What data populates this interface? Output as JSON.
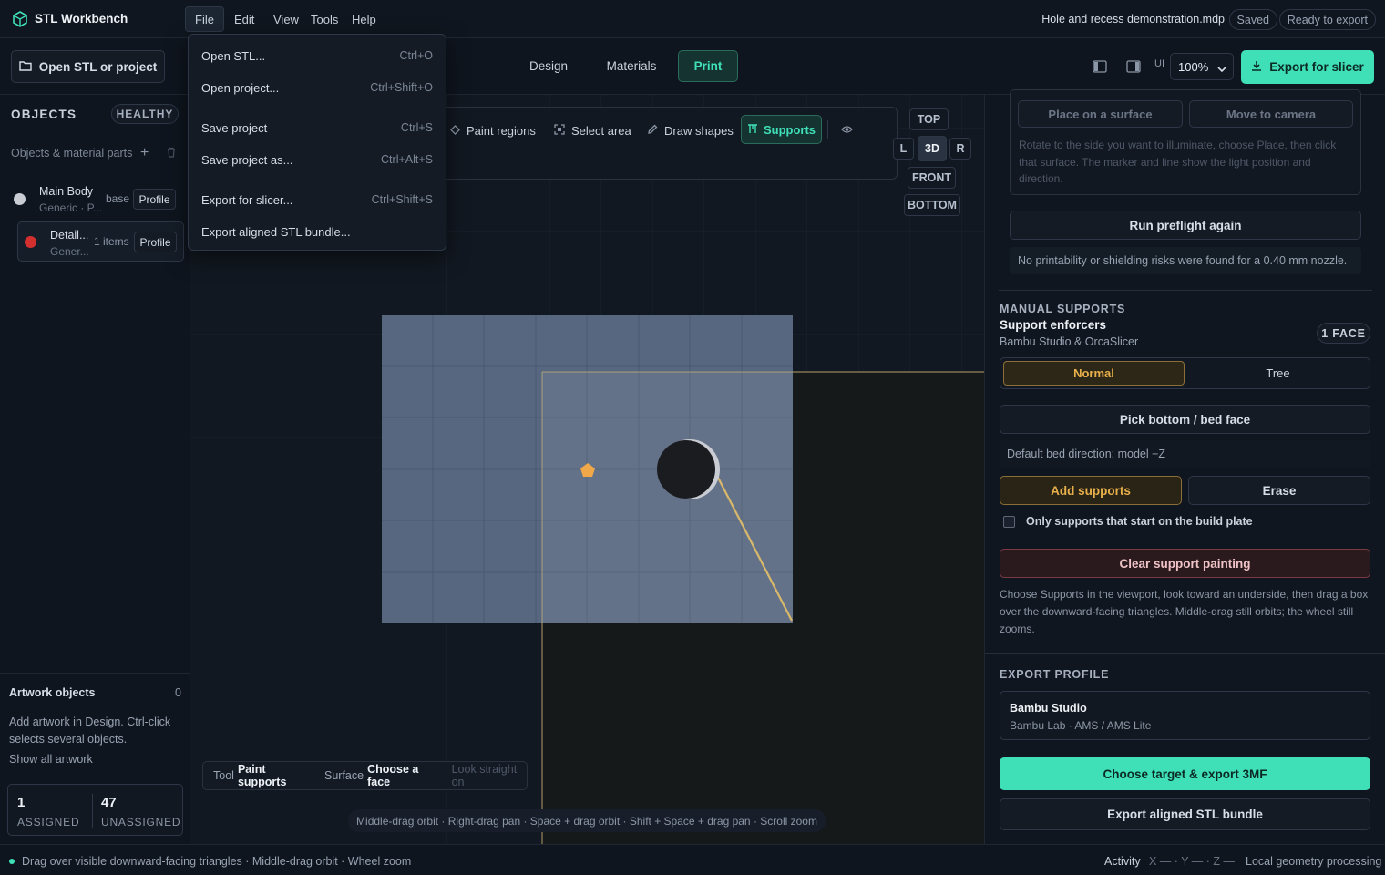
{
  "app": {
    "name": "STL Workbench",
    "file_name": "Hole and recess demonstration.mdp",
    "saved": "Saved",
    "status": "Ready to export"
  },
  "menubar": {
    "file": "File",
    "edit": "Edit",
    "view": "View",
    "tools": "Tools",
    "help": "Help"
  },
  "file_menu": [
    {
      "label": "Open STL...",
      "shortcut": "Ctrl+O"
    },
    {
      "label": "Open project...",
      "shortcut": "Ctrl+Shift+O"
    },
    {
      "label": "Save project",
      "shortcut": "Ctrl+S"
    },
    {
      "label": "Save project as...",
      "shortcut": "Ctrl+Alt+S"
    },
    {
      "label": "Export for slicer...",
      "shortcut": "Ctrl+Shift+S"
    },
    {
      "label": "Export aligned STL bundle...",
      "shortcut": ""
    }
  ],
  "toolbar": {
    "open_label": "Open STL or project",
    "tabs": [
      "Design",
      "Materials",
      "Print"
    ],
    "ui_label": "UI",
    "zoom": "100%",
    "export_label": "Export for slicer"
  },
  "sidebar": {
    "title": "OBJECTS",
    "health": "HEALTHY",
    "subtitle": "Objects & material parts",
    "objects": [
      {
        "name": "Main Body",
        "material": "Generic · P...",
        "tag": "base",
        "profile": "Profile",
        "color": "#c9ccd2"
      },
      {
        "name": "Detail...",
        "material": "Gener...",
        "tag": "1 items",
        "profile": "Profile",
        "color": "#d32f2f"
      }
    ],
    "artwork_title": "Artwork objects",
    "artwork_count": "0",
    "artwork_help": "Add artwork in Design. Ctrl-click selects several objects.",
    "show_all": "Show all artwork",
    "assigned_count": "1",
    "assigned_label": "ASSIGNED",
    "unassigned_count": "47",
    "unassigned_label": "UNASSIGNED"
  },
  "viewport": {
    "tools": [
      "Paint regions",
      "Select area",
      "Draw shapes",
      "Supports"
    ],
    "views": {
      "top": "TOP",
      "left": "L",
      "threed": "3D",
      "right": "R",
      "front": "FRONT",
      "bottom": "BOTTOM"
    },
    "tool_status": {
      "tool_label": "Tool",
      "tool_value": "Paint supports",
      "surface_label": "Surface",
      "surface_value": "Choose a face",
      "hint": "Look straight on"
    },
    "nav_hint": "Middle-drag orbit · Right-drag pan · Space + drag orbit · Shift + Space + drag pan · Scroll zoom"
  },
  "right_panel": {
    "place_surface": "Place on a surface",
    "move_camera": "Move to camera",
    "light_help": "Rotate to the side you want to illuminate, choose Place, then click that surface. The marker and line show the light position and direction.",
    "run_preflight": "Run preflight again",
    "preflight_result": "No printability or shielding risks were found for a 0.40 mm nozzle.",
    "manual_title": "MANUAL SUPPORTS",
    "enforcers_title": "Support enforcers",
    "enforcers_sub": "Bambu Studio & OrcaSlicer",
    "face_badge": "1 FACE",
    "mode_normal": "Normal",
    "mode_tree": "Tree",
    "pick_bottom": "Pick bottom / bed face",
    "bed_direction": "Default bed direction: model −Z",
    "add_supports": "Add supports",
    "erase": "Erase",
    "build_plate_only": "Only supports that start on the build plate",
    "clear_painting": "Clear support painting",
    "supports_help": "Choose Supports in the viewport, look toward an underside, then drag a box over the downward-facing triangles. Middle-drag still orbits; the wheel still zooms.",
    "export_title": "EXPORT PROFILE",
    "profile_name": "Bambu Studio",
    "profile_sub": "Bambu Lab · AMS / AMS Lite",
    "export_3mf": "Choose target & export 3MF",
    "export_stl": "Export aligned STL bundle"
  },
  "statusbar": {
    "hint": "Drag over visible downward-facing triangles · Middle-drag orbit · Wheel zoom",
    "activity": "Activity",
    "coords": "X — · Y — · Z —",
    "processing": "Local geometry processing"
  },
  "colors": {
    "accent": "#3fe0b8",
    "warning": "#e8b04a",
    "danger": "#e05a5a",
    "panel": "#10161f"
  }
}
